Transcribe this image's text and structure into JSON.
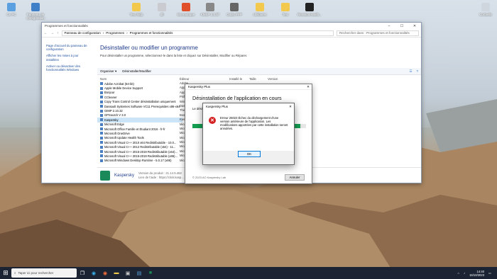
{
  "desktop": {
    "icons": [
      {
        "label": "Ce PC",
        "color": "#5aa0e0"
      },
      {
        "label": "Panneau de configuration",
        "color": "#3f7fc7"
      },
      {
        "label": "Test Mdp",
        "color": "#f2c94c"
      },
      {
        "label": "dll",
        "color": "#c9cbd0"
      },
      {
        "label": "Bureautique",
        "color": "#e0502a"
      },
      {
        "label": "KMSP 3.0.57",
        "color": "#888"
      },
      {
        "label": "Outils PPP",
        "color": "#666"
      },
      {
        "label": "Utilitaires",
        "color": "#f2c94c"
      },
      {
        "label": "Test",
        "color": "#f2c94c"
      },
      {
        "label": "RevisionHealth...",
        "color": "#222"
      },
      {
        "label": "Corbeille",
        "color": "#cfd6de"
      }
    ]
  },
  "window": {
    "title": "Programmes et fonctionnalités",
    "breadcrumb": [
      "Panneau de configuration",
      "Programmes",
      "Programmes et fonctionnalités"
    ],
    "search_placeholder": "Rechercher dans : Programmes et fonctionnalités",
    "left_links": [
      "Page d'accueil du panneau de configuration",
      "Afficher les mises à jour installées",
      "Activer ou désactiver des fonctionnalités Windows"
    ],
    "heading": "Désinstaller ou modifier un programme",
    "description": "Pour désinstaller un programme, sélectionnez-le dans la liste et cliquez sur Désinstaller, Modifier ou Réparer.",
    "toolbar": {
      "organize": "Organiser ▾",
      "uninstall": "Désinstaller/Modifier"
    },
    "columns": {
      "name": "Nom",
      "publisher": "Éditeur",
      "installed": "Installé le",
      "size": "Taille",
      "version": "Version"
    },
    "programs": [
      {
        "name": "Adobe Acrobat (64-bit)",
        "publisher": "Adobe"
      },
      {
        "name": "Apple Mobile Device Support",
        "publisher": "Apple"
      },
      {
        "name": "Bonjour",
        "publisher": "Apple"
      },
      {
        "name": "CCleaner",
        "publisher": "Piriform"
      },
      {
        "name": "Copy Trans Control Center désinstallation uniquement",
        "publisher": "Wind"
      },
      {
        "name": "Dassault Systemes Software VC11 Prerequisites x86-x64",
        "publisher": "Dass"
      },
      {
        "name": "GIMP 2.10.32",
        "publisher": "The G"
      },
      {
        "name": "GPSoutch V 3.0",
        "publisher": "Bosc"
      },
      {
        "name": "Kaspersky",
        "publisher": "Kasp"
      },
      {
        "name": "Microsoft Edge",
        "publisher": "Micro"
      },
      {
        "name": "Microsoft Office Famille et Étudiant 2016 - fr-fr",
        "publisher": "Micro"
      },
      {
        "name": "Microsoft OneDrive",
        "publisher": "Micro"
      },
      {
        "name": "Microsoft Update Health Tools",
        "publisher": "Micro"
      },
      {
        "name": "Microsoft Visual C++ 2010 x64 Redistributable - 10.0...",
        "publisher": "Micro"
      },
      {
        "name": "Microsoft Visual C++ 2012 Redistributable (x64) - 11...",
        "publisher": "Micro"
      },
      {
        "name": "Microsoft Visual C++ 2015-2019 Redistributable (x64)...",
        "publisher": "Micro"
      },
      {
        "name": "Microsoft Visual C++ 2015-2019 Redistributable (x86)...",
        "publisher": "Micro"
      },
      {
        "name": "Microsoft Windows Desktop Runtime - 5.0.17 (x86)",
        "publisher": "Micro"
      }
    ],
    "details": {
      "name": "Kaspersky",
      "version_label": "Version du produit :",
      "version": "21.14.5.462",
      "help_label": "Lien de l'aide :",
      "help": "https://click.kasp..."
    }
  },
  "kaspersky_dialog": {
    "title": "Kaspersky Plus",
    "heading": "Désinstallation de l'application en cours",
    "status": "Le désinstallation...",
    "progress": 0.95,
    "footer": "© 2023 AO Kaspersky Lab",
    "cancel": "Annuler"
  },
  "error_dialog": {
    "title": "Kaspersky Plus",
    "message": "Erreur 25023 Échec du déchargement d'une version antérieure de l'application. Les modifications apportées par cette installation seront annulées.",
    "ok": "OK"
  },
  "taskbar": {
    "search_placeholder": "Taper ici pour rechercher",
    "time": "14:40",
    "date": "15/10/2023"
  }
}
